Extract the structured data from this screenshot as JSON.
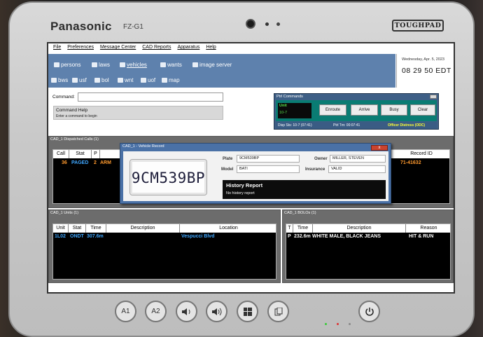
{
  "device": {
    "brand": "Panasonic",
    "model": "FZ-G1",
    "badge": "TOUGHPAD"
  },
  "menu": [
    "File",
    "Preferences",
    "Message Center",
    "CAD Reports",
    "Apparatus",
    "Help"
  ],
  "nav": {
    "row1": [
      "persons",
      "laws",
      "vehicles",
      "wants",
      "image server"
    ],
    "row2": [
      "bws",
      "usf",
      "bol",
      "wnt",
      "uof",
      "map"
    ]
  },
  "clock": {
    "date": "Wednesday, Apr. 5, 2023",
    "time": "08 29 50 EDT"
  },
  "command": {
    "label": "Command:",
    "value": "",
    "help_title": "Command Help",
    "help_text": "Enter a command to begin"
  },
  "ptrl": {
    "title": "Ptrl Commands",
    "unit_label": "Unit",
    "unit_value": "10-7",
    "buttons": [
      "Enroute",
      "Arrive",
      "Busy",
      "Clear"
    ],
    "disp_sts": "Disp Sts: 10-7 (07:41)",
    "ptrl_tm": "Ptrl Tm: 00:07:41",
    "distress": "Officer Distress (ODC)"
  },
  "dispatched": {
    "title": "CAD_1 Dispatched Calls (1)",
    "headers": [
      "Call",
      "Stat",
      "P",
      "Record ID"
    ],
    "row": {
      "call": "36",
      "stat": "PAGED",
      "p": "2",
      "desc": "ARM",
      "record_id": "71-41632"
    }
  },
  "units": {
    "title": "CAD_1 Units (1)",
    "headers": [
      "Unit",
      "Stat",
      "Time",
      "Description",
      "Location"
    ],
    "row": {
      "unit": "1L02",
      "stat": "ONDT",
      "time": "307.6m",
      "description": "",
      "location": "Vespucci Blvd"
    }
  },
  "bolos": {
    "title": "CAD_1 BOLOs (1)",
    "headers": [
      "T",
      "Time",
      "Description",
      "Reason"
    ],
    "row": {
      "t": "P",
      "time": "232.6m",
      "description": "WHITE MALE, BLACK JEANS",
      "reason": "HIT & RUN"
    }
  },
  "vehicle": {
    "title": "CAD_1 - Vehicle Record",
    "close": "x",
    "plate_display": "9CM539BP",
    "plate_label": "Plate",
    "plate": "9CM539BP",
    "model_label": "Model",
    "model": "BATI",
    "owner_label": "Owner",
    "owner": "MILLER, STEVEN",
    "insurance_label": "Insurance",
    "insurance": "VALID",
    "history_title": "History Report",
    "history_text": "No history report"
  },
  "hw_buttons": [
    "A1",
    "A2"
  ],
  "colors": {
    "nav_bg": "#5e81ad",
    "ptrl_bg": "#0a7c73",
    "paged": "#3fa7ff",
    "orange": "#ff9a2e",
    "distress": "#ffff33"
  }
}
